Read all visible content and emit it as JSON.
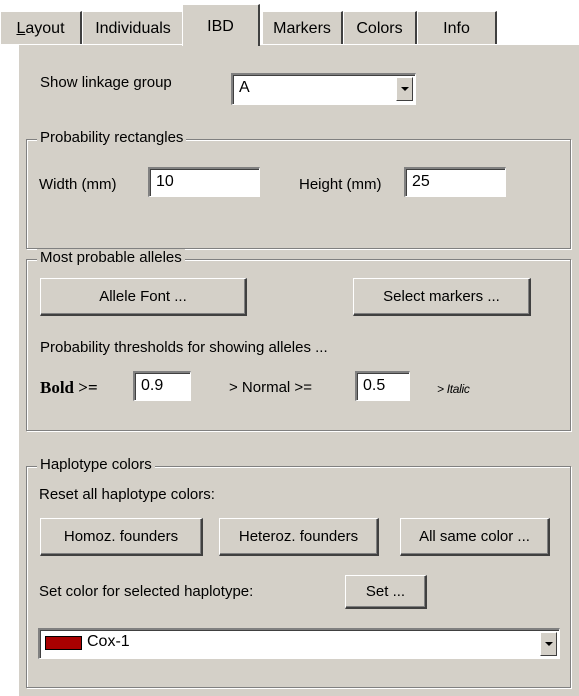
{
  "tabs": [
    {
      "label_first": "L",
      "label_rest": "ayout"
    },
    {
      "label": "Individuals"
    },
    {
      "label": "IBD"
    },
    {
      "label": "Markers"
    },
    {
      "label": "Colors"
    },
    {
      "label": "Info"
    }
  ],
  "linkage": {
    "label": "Show linkage group",
    "value": "A"
  },
  "prob_rect": {
    "legend": "Probability rectangles",
    "width_label": "Width (mm)",
    "width_value": "10",
    "height_label": "Height (mm)",
    "height_value": "25"
  },
  "alleles": {
    "legend": "Most probable alleles",
    "font_button": "Allele Font ...",
    "select_markers_button": "Select markers ...",
    "thresholds_label": "Probability thresholds for showing alleles ...",
    "bold_label": "Bold >=",
    "bold_value": "0.9",
    "normal_label": "> Normal >=",
    "normal_value": "0.5",
    "italic_label": "> Italic"
  },
  "haplotype": {
    "legend": "Haplotype colors",
    "reset_label": "Reset all haplotype colors:",
    "homoz_button": "Homoz. founders",
    "heteroz_button": "Heteroz. founders",
    "same_color_button": "All same color ...",
    "set_label": "Set color for selected haplotype:",
    "set_button": "Set ...",
    "selected_value": "Cox-1",
    "selected_color": "#a80000"
  }
}
